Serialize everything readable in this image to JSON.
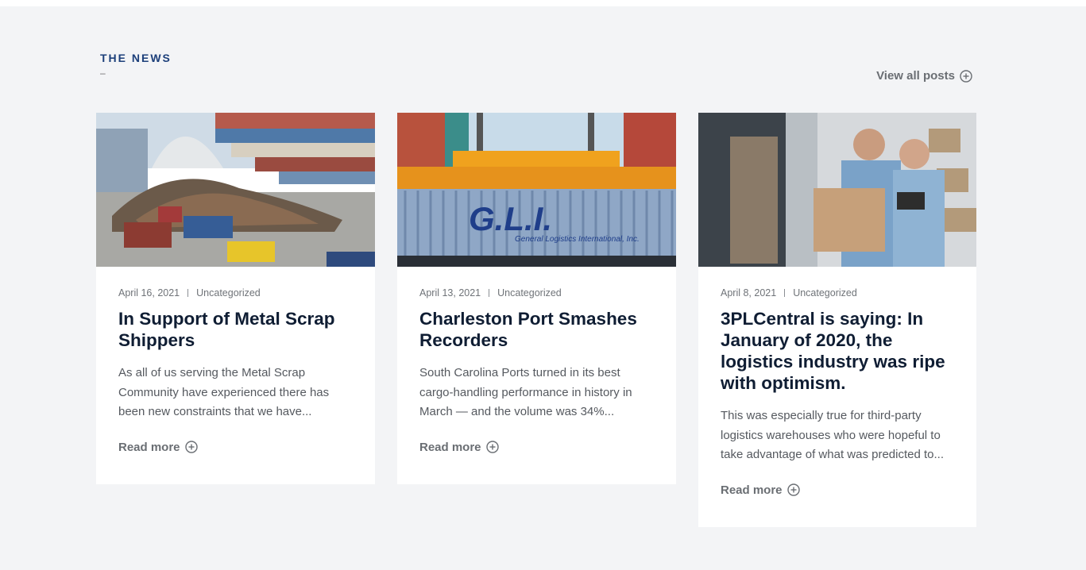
{
  "section": {
    "eyebrow": "THE NEWS",
    "eyebrow_dash": "–",
    "view_all_label": "View all posts"
  },
  "colors": {
    "accent": "#1c3f7a",
    "title": "#0f1d33",
    "muted": "#6a6e73",
    "background": "#f3f4f6"
  },
  "icons": {
    "read_more": "plus-circle-icon"
  },
  "posts": [
    {
      "date": "April 16, 2021",
      "category": "Uncategorized",
      "title": "In Support of Metal Scrap Shippers",
      "excerpt": "As all of us serving the Metal Scrap Community have experienced there has been new constraints that we have...",
      "read_more": "Read more"
    },
    {
      "date": "April 13, 2021",
      "category": "Uncategorized",
      "title": "Charleston Port Smashes Recorders",
      "excerpt": "South Carolina Ports turned in its best cargo-handling performance in history in March — and the volume was 34%...",
      "read_more": "Read more",
      "image_text": "G.L.I.",
      "image_subtext": "General Logistics International, Inc."
    },
    {
      "date": "April 8, 2021",
      "category": "Uncategorized",
      "title": "3PLCentral is saying: In January of 2020, the logistics industry was ripe with optimism.",
      "excerpt": "This was especially true for third-party logistics warehouses who were hopeful to take advantage of what was predicted to...",
      "read_more": "Read more"
    }
  ]
}
